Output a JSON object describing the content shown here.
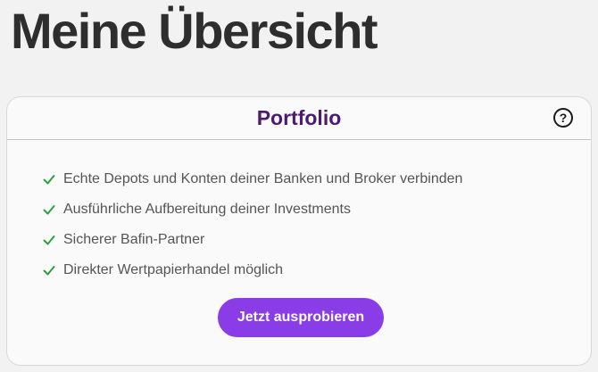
{
  "page": {
    "title": "Meine Übersicht"
  },
  "card": {
    "title": "Portfolio",
    "help_icon": "question-circle-icon",
    "help_glyph": "?",
    "features": [
      {
        "icon": "check-icon",
        "label": "Echte Depots und Konten deiner Banken und Broker verbinden"
      },
      {
        "icon": "check-icon",
        "label": "Ausführliche Aufbereitung deiner Investments"
      },
      {
        "icon": "check-icon",
        "label": "Sicherer Bafin-Partner"
      },
      {
        "icon": "check-icon",
        "label": "Direkter Wertpapierhandel möglich"
      }
    ],
    "cta_label": "Jetzt ausprobieren"
  },
  "colors": {
    "page_background": "#f2f2f2",
    "title_text": "#2e2e2e",
    "card_title": "#4b1a73",
    "check": "#2e9e3e",
    "feature_text": "#555555",
    "cta_background": "#8a3ce6",
    "cta_text": "#ffffff"
  }
}
